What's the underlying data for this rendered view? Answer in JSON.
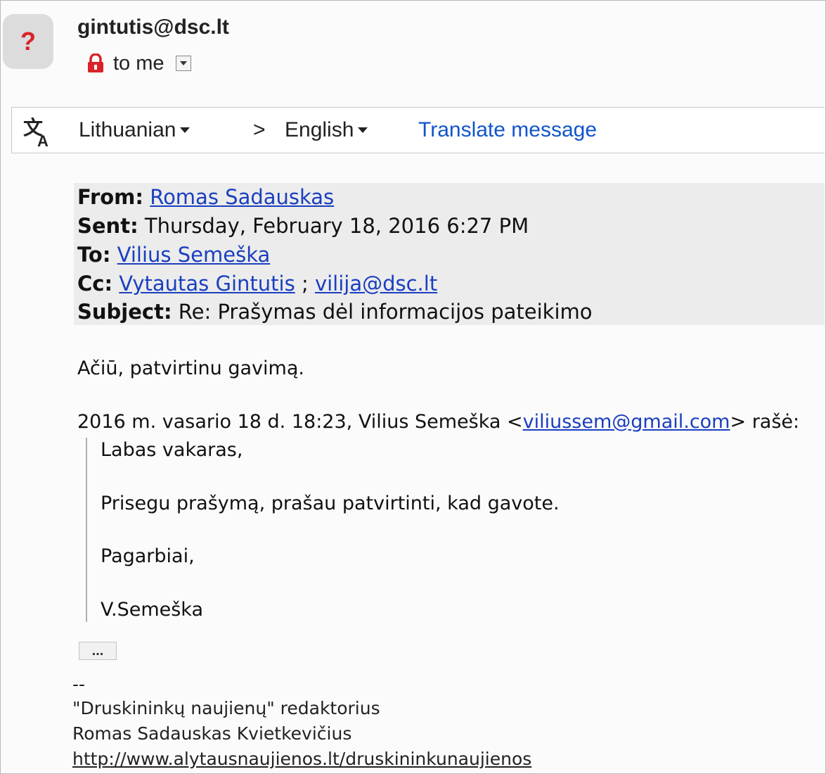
{
  "header": {
    "sender": "gintutis@dsc.lt",
    "recipient": "to me",
    "avatar_symbol": "?",
    "lock_color": "#d8232a"
  },
  "translate": {
    "source_lang": "Lithuanian",
    "arrow": ">",
    "target_lang": "English",
    "action": "Translate message"
  },
  "quoted_header": {
    "from_label": "From:",
    "from_name": "Romas Sadauskas",
    "sent_label": "Sent:",
    "sent_value": "Thursday, February 18, 2016 6:27 PM",
    "to_label": "To:",
    "to_name": "Vilius Semeška",
    "cc_label": "Cc:",
    "cc_1": "Vytautas Gintutis",
    "cc_sep": ";",
    "cc_2": "vilija@dsc.lt",
    "subject_label": "Subject:",
    "subject_value": "Re: Prašymas dėl informacijos pateikimo"
  },
  "body": {
    "reply": "Ačiū, patvirtinu gavimą.",
    "quote_intro_pre": "2016 m. vasario 18 d. 18:23, Vilius Semeška <",
    "quote_email": "viliussem@gmail.com",
    "quote_intro_post": "> rašė:",
    "quote": [
      "Labas vakaras,",
      "Prisegu prašymą, prašau patvirtinti, kad gavote.",
      "Pagarbiai,",
      "V.Semeška"
    ],
    "show_trimmed": "..."
  },
  "signature": {
    "dashes": "--",
    "line1": "\"Druskininkų naujienų\" redaktorius",
    "line2": "Romas Sadauskas Kvietkevičius",
    "url": "http://www.alytausnaujienos.lt/druskininkunaujienos"
  },
  "colors": {
    "link": "#1155cc",
    "quoted_link": "#1a3fbf",
    "header_block_bg": "#ececec"
  }
}
